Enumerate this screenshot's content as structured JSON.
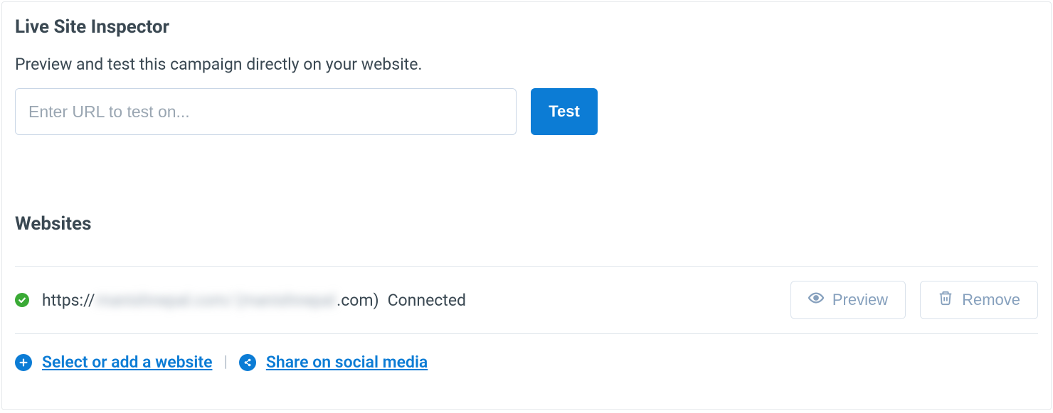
{
  "inspector": {
    "title": "Live Site Inspector",
    "subtitle": "Preview and test this campaign directly on your website.",
    "urlPlaceholder": "Enter URL to test on...",
    "testLabel": "Test"
  },
  "websites": {
    "title": "Websites",
    "items": [
      {
        "prefix": "https://",
        "obscured1": "manishnepal.com/",
        "obscured2": "(manishnepal",
        "suffix": ".com)",
        "status": "Connected"
      }
    ],
    "actions": {
      "preview": "Preview",
      "remove": "Remove"
    }
  },
  "footer": {
    "addWebsite": "Select or add a website",
    "share": "Share on social media"
  }
}
